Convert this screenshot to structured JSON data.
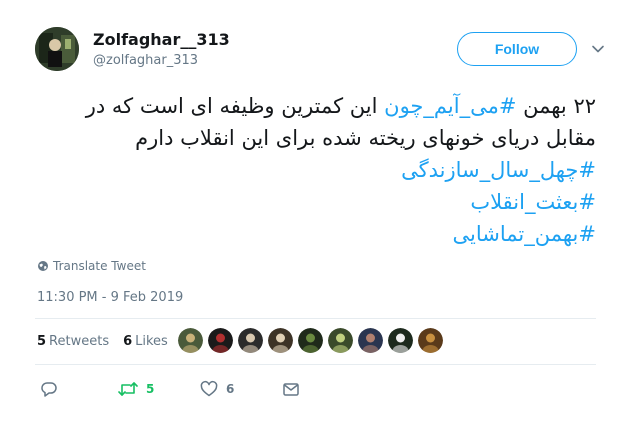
{
  "tweet": {
    "name": "Zolfaghar__313",
    "handle": "@zolfaghar_313",
    "follow_label": "Follow",
    "text": {
      "line1_prefix": "۲۲ بهمن ",
      "line1_hashtag": "#می_آیم_چون",
      "line1_suffix": " این کمترین وظیفه ای است که در",
      "line2": "مقابل دریای خونهای ریخته شده برای این انقلاب دارم",
      "hashtags": [
        "#چهل_سال_سازندگی",
        "#بعثت_انقلاب",
        "#بهمن_تماشایی"
      ]
    },
    "translate_label": "Translate Tweet",
    "timestamp": "11:30 PM - 9 Feb 2019",
    "retweets_count": "5",
    "retweets_label": "Retweets",
    "likes_count": "6",
    "likes_label": "Likes",
    "action_retweet_count": "5",
    "action_like_count": "6"
  },
  "colors": {
    "accent": "#1da1f2",
    "text": "#14171a",
    "muted": "#657786",
    "retweet_green": "#17bf63",
    "separator": "#e6ecf0"
  },
  "icons": {
    "caret": "chevron-down-icon",
    "globe": "globe-icon",
    "reply": "reply-icon",
    "retweet": "retweet-icon",
    "like": "heart-icon",
    "dm": "envelope-icon"
  },
  "likers": [
    {
      "color": "#4a5a3a",
      "accent": "#c9b27a"
    },
    {
      "color": "#1a1a1a",
      "accent": "#b03030"
    },
    {
      "color": "#2b2b2b",
      "accent": "#d8c8b0"
    },
    {
      "color": "#3d3326",
      "accent": "#e0d0b5"
    },
    {
      "color": "#1f2a1a",
      "accent": "#6a8a40"
    },
    {
      "color": "#3a4a2a",
      "accent": "#c0d080"
    },
    {
      "color": "#2a3550",
      "accent": "#b08070"
    },
    {
      "color": "#1d2a1d",
      "accent": "#f0f0f0"
    },
    {
      "color": "#5a3a1a",
      "accent": "#c89040"
    }
  ]
}
